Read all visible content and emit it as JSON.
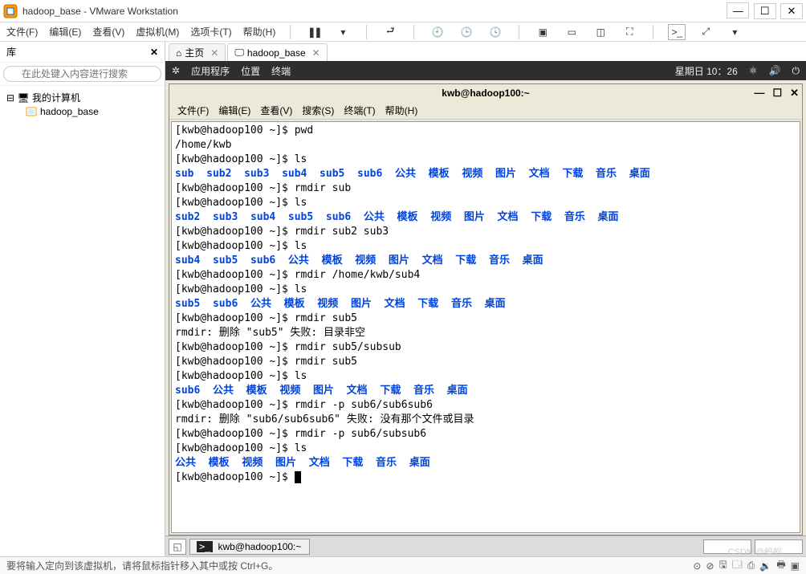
{
  "window": {
    "title": "hadoop_base - VMware Workstation"
  },
  "menu": {
    "items": [
      "文件(F)",
      "编辑(E)",
      "查看(V)",
      "虚拟机(M)",
      "选项卡(T)",
      "帮助(H)"
    ]
  },
  "sidebar": {
    "title": "库",
    "search_placeholder": "在此处键入内容进行搜索",
    "root": "我的计算机",
    "child": "hadoop_base"
  },
  "tabs": {
    "home": "主页",
    "vm": "hadoop_base"
  },
  "vm_topbar": {
    "apps": "应用程序",
    "places": "位置",
    "terminal": "终端",
    "clock": "星期日 10：26"
  },
  "inner": {
    "title": "kwb@hadoop100:~",
    "menu": [
      "文件(F)",
      "编辑(E)",
      "查看(V)",
      "搜索(S)",
      "终端(T)",
      "帮助(H)"
    ]
  },
  "terminal": {
    "lines": [
      {
        "t": "prompt",
        "cmd": "pwd"
      },
      {
        "t": "plain",
        "text": "/home/kwb"
      },
      {
        "t": "prompt",
        "cmd": "ls"
      },
      {
        "t": "dirs",
        "items": [
          "sub",
          "sub2",
          "sub3",
          "sub4",
          "sub5",
          "sub6",
          "公共",
          "模板",
          "视频",
          "图片",
          "文档",
          "下载",
          "音乐",
          "桌面"
        ]
      },
      {
        "t": "prompt",
        "cmd": "rmdir sub"
      },
      {
        "t": "prompt",
        "cmd": "ls"
      },
      {
        "t": "dirs",
        "items": [
          "sub2",
          "sub3",
          "sub4",
          "sub5",
          "sub6",
          "公共",
          "模板",
          "视频",
          "图片",
          "文档",
          "下载",
          "音乐",
          "桌面"
        ]
      },
      {
        "t": "prompt",
        "cmd": "rmdir sub2 sub3"
      },
      {
        "t": "prompt",
        "cmd": "ls"
      },
      {
        "t": "dirs",
        "items": [
          "sub4",
          "sub5",
          "sub6",
          "公共",
          "模板",
          "视频",
          "图片",
          "文档",
          "下载",
          "音乐",
          "桌面"
        ]
      },
      {
        "t": "prompt",
        "cmd": "rmdir /home/kwb/sub4"
      },
      {
        "t": "prompt",
        "cmd": "ls"
      },
      {
        "t": "dirs",
        "items": [
          "sub5",
          "sub6",
          "公共",
          "模板",
          "视频",
          "图片",
          "文档",
          "下载",
          "音乐",
          "桌面"
        ]
      },
      {
        "t": "prompt",
        "cmd": "rmdir sub5"
      },
      {
        "t": "plain",
        "text": "rmdir: 删除 \"sub5\" 失败: 目录非空"
      },
      {
        "t": "prompt",
        "cmd": "rmdir sub5/subsub"
      },
      {
        "t": "prompt",
        "cmd": "rmdir sub5"
      },
      {
        "t": "prompt",
        "cmd": "ls"
      },
      {
        "t": "dirs",
        "items": [
          "sub6",
          "公共",
          "模板",
          "视频",
          "图片",
          "文档",
          "下载",
          "音乐",
          "桌面"
        ]
      },
      {
        "t": "prompt",
        "cmd": "rmdir -p sub6/sub6sub6"
      },
      {
        "t": "plain",
        "text": "rmdir: 删除 \"sub6/sub6sub6\" 失败: 没有那个文件或目录"
      },
      {
        "t": "prompt",
        "cmd": "rmdir -p sub6/subsub6"
      },
      {
        "t": "prompt",
        "cmd": "ls"
      },
      {
        "t": "dirs",
        "items": [
          "公共",
          "模板",
          "视频",
          "图片",
          "文档",
          "下载",
          "音乐",
          "桌面"
        ]
      },
      {
        "t": "prompt",
        "cmd": "",
        "cursor": true
      }
    ],
    "prompt_prefix": "[kwb@hadoop100 ~]$ "
  },
  "taskbar": {
    "task": "kwb@hadoop100:~"
  },
  "status": {
    "text": "要将输入定向到该虚拟机，请将鼠标指针移入其中或按 Ctrl+G。"
  },
  "watermark": "CSDN @蚂蚁"
}
